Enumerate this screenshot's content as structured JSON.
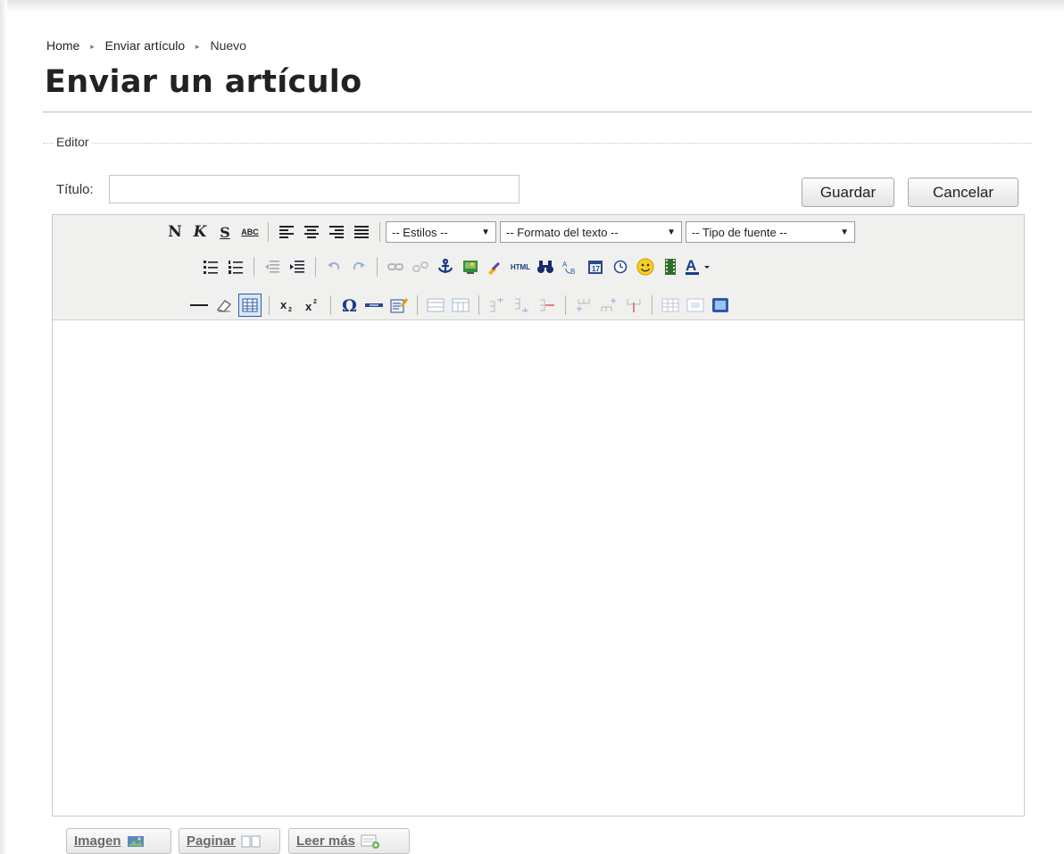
{
  "breadcrumb": {
    "items": [
      "Home",
      "Enviar artículo",
      "Nuevo"
    ],
    "separator": "▸"
  },
  "page": {
    "title": "Enviar un artículo"
  },
  "editor_section": {
    "legend": "Editor",
    "title_label": "Título:",
    "title_value": "",
    "save_label": "Guardar",
    "cancel_label": "Cancelar"
  },
  "toolbar": {
    "styles_select": "-- Estilos --",
    "format_select": "-- Formato del texto --",
    "font_select": "-- Tipo de fuente --",
    "bold_glyph": "N",
    "italic_glyph": "K",
    "strike_glyph": "S",
    "spell_glyph": "ABC",
    "html_glyph": "HTML",
    "icons_row1": [
      "bold-icon",
      "italic-icon",
      "strikethrough-icon",
      "spellcheck-icon",
      "align-left-icon",
      "align-center-icon",
      "align-right-icon",
      "align-justify-icon"
    ],
    "icons_row2": [
      "bullet-list-icon",
      "numbered-list-icon",
      "outdent-icon",
      "indent-icon",
      "undo-icon",
      "redo-icon",
      "link-icon",
      "unlink-icon",
      "anchor-icon",
      "image-icon",
      "cleanup-icon",
      "html-source-icon",
      "find-icon",
      "replace-icon",
      "insert-date-icon",
      "insert-time-icon",
      "emoticon-icon",
      "media-icon",
      "text-color-icon"
    ],
    "icons_row3": [
      "horizontal-rule-icon",
      "remove-format-icon",
      "visual-aid-icon",
      "subscript-icon",
      "superscript-icon",
      "special-char-icon",
      "advanced-hr-icon",
      "edit-attributes-icon",
      "table-icon",
      "table-props-icon",
      "row-before-icon",
      "row-after-icon",
      "delete-row-icon",
      "col-before-icon",
      "col-after-icon",
      "delete-col-icon",
      "split-cells-icon",
      "merge-cells-icon",
      "fullscreen-icon"
    ]
  },
  "bottom_buttons": {
    "image_label": "Imagen",
    "pagebreak_label": "Paginar",
    "readmore_label": "Leer más"
  }
}
